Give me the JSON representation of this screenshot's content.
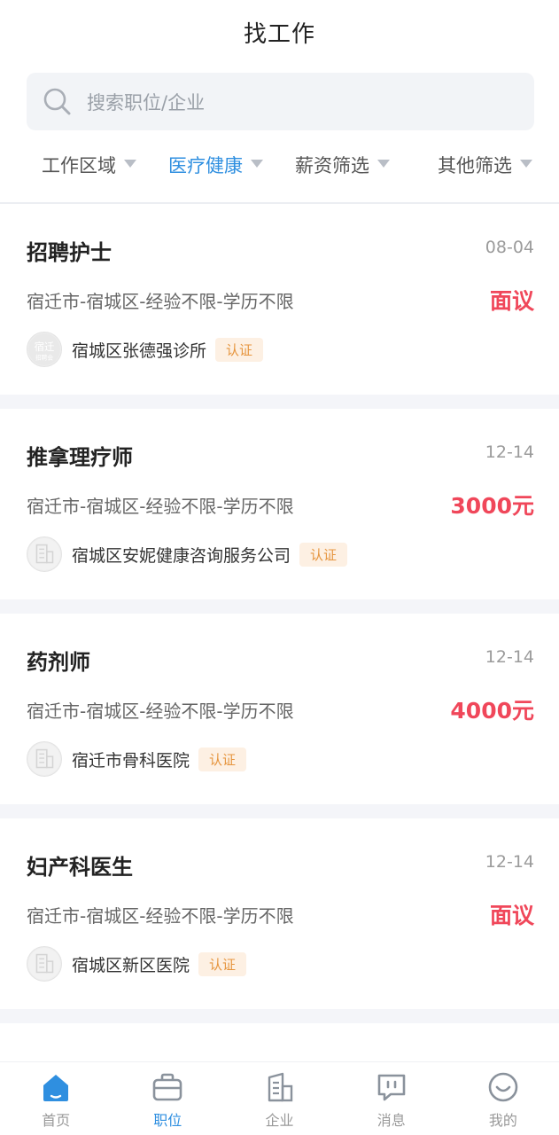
{
  "header": {
    "title": "找工作"
  },
  "search": {
    "placeholder": "搜索职位/企业"
  },
  "filters": [
    {
      "label": "工作区域",
      "active": false
    },
    {
      "label": "医疗健康",
      "active": true
    },
    {
      "label": "薪资筛选",
      "active": false
    },
    {
      "label": "其他筛选",
      "active": false
    }
  ],
  "jobs": [
    {
      "title": "招聘护士",
      "date": "08-04",
      "meta": "宿迁市-宿城区-经验不限-学历不限",
      "salary": "面议",
      "company": "宿城区张德强诊所",
      "badge": "认证",
      "logo": "宿迁招聘会"
    },
    {
      "title": "推拿理疗师",
      "date": "12-14",
      "meta": "宿迁市-宿城区-经验不限-学历不限",
      "salary": "3000元",
      "company": "宿城区安妮健康咨询服务公司",
      "badge": "认证",
      "logo": "building"
    },
    {
      "title": "药剂师",
      "date": "12-14",
      "meta": "宿迁市-宿城区-经验不限-学历不限",
      "salary": "4000元",
      "company": "宿迁市骨科医院",
      "badge": "认证",
      "logo": "building"
    },
    {
      "title": "妇产科医生",
      "date": "12-14",
      "meta": "宿迁市-宿城区-经验不限-学历不限",
      "salary": "面议",
      "company": "宿城区新区医院",
      "badge": "认证",
      "logo": "building"
    }
  ],
  "tabbar": [
    {
      "label": "首页",
      "icon": "home-icon",
      "active": false
    },
    {
      "label": "职位",
      "icon": "briefcase-icon",
      "active": true
    },
    {
      "label": "企业",
      "icon": "building-icon",
      "active": false
    },
    {
      "label": "消息",
      "icon": "message-icon",
      "active": false
    },
    {
      "label": "我的",
      "icon": "profile-icon",
      "active": false
    }
  ],
  "colors": {
    "accent": "#2f8fe0",
    "salary": "#f0475a",
    "badge_bg": "#fdf0e3",
    "badge_text": "#e6953e"
  }
}
